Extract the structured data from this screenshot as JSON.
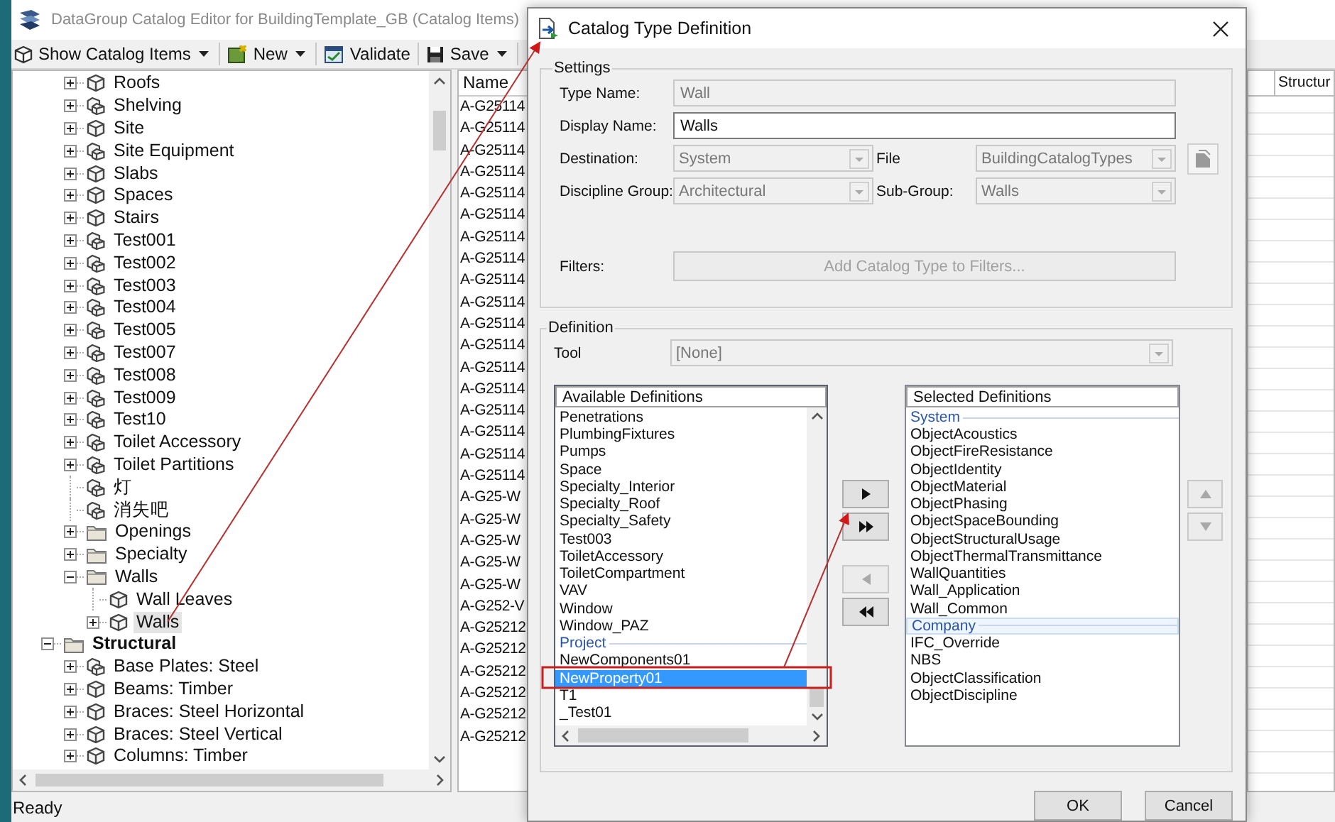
{
  "main_window": {
    "title": "DataGroup Catalog Editor for BuildingTemplate_GB (Catalog Items)",
    "toolbar": [
      {
        "label": "Show Catalog Items",
        "dropdown": true
      },
      {
        "label": "New",
        "dropdown": true
      },
      {
        "label": "Validate",
        "dropdown": false
      },
      {
        "label": "Save",
        "dropdown": true
      }
    ],
    "tree": [
      {
        "children": [
          {
            "label": "Roofs",
            "kind": "cube",
            "expandable": true,
            "expanded": false,
            "selected": false
          },
          {
            "label": "Shelving",
            "kind": "cube_set",
            "expandable": true,
            "expanded": false,
            "selected": false
          },
          {
            "label": "Site",
            "kind": "cube",
            "expandable": true,
            "expanded": false,
            "selected": false
          },
          {
            "label": "Site Equipment",
            "kind": "cube_set",
            "expandable": true,
            "expanded": false,
            "selected": false
          },
          {
            "label": "Slabs",
            "kind": "cube",
            "expandable": true,
            "expanded": false,
            "selected": false
          },
          {
            "label": "Spaces",
            "kind": "cube",
            "expandable": true,
            "expanded": false,
            "selected": false
          },
          {
            "label": "Stairs",
            "kind": "cube",
            "expandable": true,
            "expanded": false,
            "selected": false
          },
          {
            "label": "Test001",
            "kind": "cube_set",
            "expandable": true,
            "expanded": false,
            "selected": false
          },
          {
            "label": "Test002",
            "kind": "cube_set",
            "expandable": true,
            "expanded": false,
            "selected": false
          },
          {
            "label": "Test003",
            "kind": "cube_set",
            "expandable": true,
            "expanded": false,
            "selected": false
          },
          {
            "label": "Test004",
            "kind": "cube_set",
            "expandable": true,
            "expanded": false,
            "selected": false
          },
          {
            "label": "Test005",
            "kind": "cube_set",
            "expandable": true,
            "expanded": false,
            "selected": false
          },
          {
            "label": "Test007",
            "kind": "cube_set",
            "expandable": true,
            "expanded": false,
            "selected": false
          },
          {
            "label": "Test008",
            "kind": "cube_set",
            "expandable": true,
            "expanded": false,
            "selected": false
          },
          {
            "label": "Test009",
            "kind": "cube_set",
            "expandable": true,
            "expanded": false,
            "selected": false
          },
          {
            "label": "Test10",
            "kind": "cube_set",
            "expandable": true,
            "expanded": false,
            "selected": false
          },
          {
            "label": "Toilet Accessory",
            "kind": "cube_set",
            "expandable": true,
            "expanded": false,
            "selected": false
          },
          {
            "label": "Toilet Partitions",
            "kind": "cube_set",
            "expandable": true,
            "expanded": false,
            "selected": false
          },
          {
            "label": "灯",
            "kind": "cube_set",
            "expandable": false,
            "selected": false
          },
          {
            "label": "消失吧",
            "kind": "cube_set",
            "expandable": false,
            "selected": false
          },
          {
            "label": "Openings",
            "kind": "folder",
            "expandable": true,
            "expanded": false,
            "selected": false
          },
          {
            "label": "Specialty",
            "kind": "folder",
            "expandable": true,
            "expanded": false,
            "selected": false
          },
          {
            "label": "Walls",
            "kind": "folder",
            "expandable": true,
            "expanded": true,
            "selected": false,
            "children": [
              {
                "label": "Wall Leaves",
                "kind": "cube",
                "expandable": false,
                "selected": false
              },
              {
                "label": "Walls",
                "kind": "cube",
                "expandable": true,
                "expanded": false,
                "selected": true
              }
            ]
          }
        ]
      },
      {
        "label": "Structural",
        "kind": "discipline",
        "expandable": true,
        "expanded": true,
        "selected": false,
        "children": [
          {
            "label": "Base Plates: Steel",
            "kind": "cube_set",
            "expandable": true,
            "expanded": false,
            "selected": false
          },
          {
            "label": "Beams: Timber",
            "kind": "cube",
            "expandable": true,
            "expanded": false,
            "selected": false
          },
          {
            "label": "Braces: Steel Horizontal",
            "kind": "cube",
            "expandable": true,
            "expanded": false,
            "selected": false
          },
          {
            "label": "Braces: Steel Vertical",
            "kind": "cube",
            "expandable": true,
            "expanded": false,
            "selected": false
          },
          {
            "label": "Columns: Timber",
            "kind": "cube",
            "expandable": true,
            "expanded": false,
            "selected": false
          }
        ]
      }
    ],
    "list": {
      "header": "Name",
      "rows": [
        "A-G25114",
        "A-G25114",
        "A-G25114",
        "A-G25114",
        "A-G25114",
        "A-G25114",
        "A-G25114",
        "A-G25114",
        "A-G25114",
        "A-G25114",
        "A-G25114",
        "A-G25114",
        "A-G25114",
        "A-G25114",
        "A-G25114",
        "A-G25114",
        "A-G25114",
        "A-G25114",
        "A-G25-W",
        "A-G25-W",
        "A-G25-W",
        "A-G25-W",
        "A-G25-W",
        "A-G252-V",
        "A-G25212",
        "A-G25212",
        "A-G25212",
        "A-G25212",
        "A-G25212",
        "A-G25212"
      ]
    },
    "grid": {
      "header": "Structur"
    },
    "status_bar": "Ready"
  },
  "dialog": {
    "title": "Catalog Type Definition",
    "settings": {
      "legend": "Settings",
      "type_name": {
        "label": "Type Name:",
        "value": "Wall",
        "disabled": true
      },
      "display_name": {
        "label": "Display Name:",
        "value": "Walls",
        "disabled": false
      },
      "destination": {
        "label": "Destination:",
        "value": "System",
        "disabled": true
      },
      "file": {
        "label": "File",
        "value": "BuildingCatalogTypes",
        "disabled": true
      },
      "file_button": {
        "disabled": true
      },
      "discipline_group": {
        "label": "Discipline Group:",
        "value": "Architectural",
        "disabled": true
      },
      "sub_group": {
        "label": "Sub-Group:",
        "value": "Walls",
        "disabled": true
      },
      "filters": {
        "label": "Filters:",
        "button": "Add Catalog Type to Filters...",
        "disabled": true
      }
    },
    "definition": {
      "legend": "Definition",
      "tool": {
        "label": "Tool",
        "value": "[None]",
        "disabled": true
      },
      "available": {
        "header": "Available Definitions",
        "focused": true,
        "items": [
          {
            "text": "Penetrations",
            "kind": "item",
            "selected": false
          },
          {
            "text": "PlumbingFixtures",
            "kind": "item",
            "selected": false
          },
          {
            "text": "Pumps",
            "kind": "item",
            "selected": false
          },
          {
            "text": "Space",
            "kind": "item",
            "selected": false
          },
          {
            "text": "Specialty_Interior",
            "kind": "item",
            "selected": false
          },
          {
            "text": "Specialty_Roof",
            "kind": "item",
            "selected": false
          },
          {
            "text": "Specialty_Safety",
            "kind": "item",
            "selected": false
          },
          {
            "text": "Test003",
            "kind": "item",
            "selected": false
          },
          {
            "text": "ToiletAccessory",
            "kind": "item",
            "selected": false
          },
          {
            "text": "ToiletCompartment",
            "kind": "item",
            "selected": false
          },
          {
            "text": "VAV",
            "kind": "item",
            "selected": false
          },
          {
            "text": "Window",
            "kind": "item",
            "selected": false
          },
          {
            "text": "Window_PAZ",
            "kind": "item",
            "selected": false
          },
          {
            "text": "Project",
            "kind": "group",
            "selected": false
          },
          {
            "text": "NewComponents01",
            "kind": "item",
            "selected": false
          },
          {
            "text": "NewProperty01",
            "kind": "item",
            "selected": true
          },
          {
            "text": "T1",
            "kind": "item",
            "selected": false
          },
          {
            "text": "_Test01",
            "kind": "item",
            "selected": false
          }
        ]
      },
      "move_buttons": [
        {
          "kind": "add",
          "disabled": false
        },
        {
          "kind": "add_all",
          "disabled": false
        },
        {
          "kind": "remove",
          "disabled": true
        },
        {
          "kind": "remove_all",
          "disabled": false
        }
      ],
      "selected": {
        "header": "Selected Definitions",
        "focused": false,
        "items": [
          {
            "text": "System",
            "kind": "group",
            "selected": false
          },
          {
            "text": "ObjectAcoustics",
            "kind": "item",
            "selected": false
          },
          {
            "text": "ObjectFireResistance",
            "kind": "item",
            "selected": false
          },
          {
            "text": "ObjectIdentity",
            "kind": "item",
            "selected": false
          },
          {
            "text": "ObjectMaterial",
            "kind": "item",
            "selected": false
          },
          {
            "text": "ObjectPhasing",
            "kind": "item",
            "selected": false
          },
          {
            "text": "ObjectSpaceBounding",
            "kind": "item",
            "selected": false
          },
          {
            "text": "ObjectStructuralUsage",
            "kind": "item",
            "selected": false
          },
          {
            "text": "ObjectThermalTransmittance",
            "kind": "item",
            "selected": false
          },
          {
            "text": "WallQuantities",
            "kind": "item",
            "selected": false
          },
          {
            "text": "Wall_Application",
            "kind": "item",
            "selected": false
          },
          {
            "text": "Wall_Common",
            "kind": "item",
            "selected": false
          },
          {
            "text": "Company",
            "kind": "group",
            "selected": true
          },
          {
            "text": "IFC_Override",
            "kind": "item",
            "selected": false
          },
          {
            "text": "NBS",
            "kind": "item",
            "selected": false
          },
          {
            "text": "ObjectClassification",
            "kind": "item",
            "selected": false
          },
          {
            "text": "ObjectDiscipline",
            "kind": "item",
            "selected": false
          }
        ]
      },
      "order_buttons": [
        {
          "kind": "up",
          "disabled": true
        },
        {
          "kind": "down",
          "disabled": true
        }
      ]
    },
    "buttons": [
      {
        "label": "OK"
      },
      {
        "label": "Cancel"
      }
    ]
  }
}
